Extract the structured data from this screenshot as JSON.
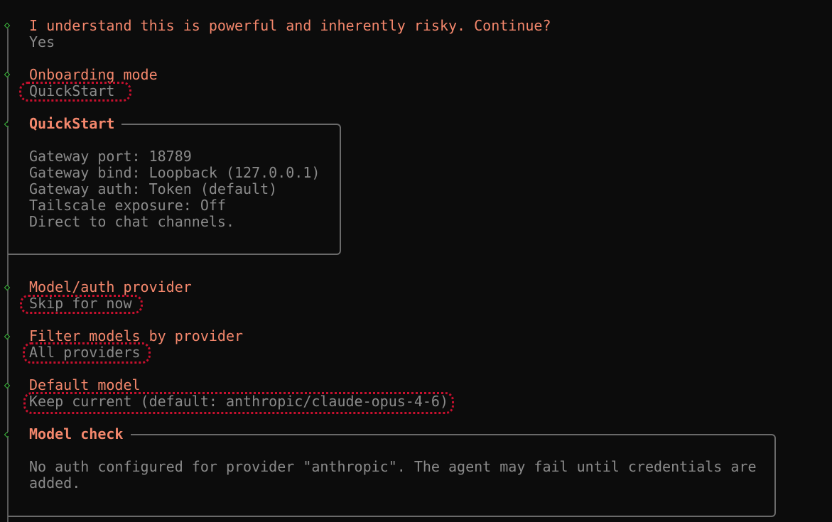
{
  "steps": {
    "risk": {
      "question": "I understand this is powerful and inherently risky. Continue?",
      "answer": "Yes"
    },
    "mode": {
      "question": "Onboarding mode",
      "answer": "QuickStart"
    },
    "quickstart_box": {
      "title": "QuickStart",
      "lines": [
        "Gateway port: 18789",
        "Gateway bind: Loopback (127.0.0.1)",
        "Gateway auth: Token (default)",
        "Tailscale exposure: Off",
        "Direct to chat channels."
      ]
    },
    "provider": {
      "question": "Model/auth provider",
      "answer": "Skip for now"
    },
    "filter": {
      "question": "Filter models by provider",
      "answer": "All providers"
    },
    "default_model": {
      "question": "Default model",
      "answer": "Keep current (default: anthropic/claude-opus-4-6)"
    },
    "model_check_box": {
      "title": "Model check",
      "lines": [
        "No auth configured for provider \"anthropic\". The agent may fail until credentials are",
        "added."
      ]
    }
  },
  "colors": {
    "background": "#0c0c0c",
    "prompt": "#f4876c",
    "value": "#8a8a8a",
    "bullet": "#3fbf3f",
    "highlight": "#c8102e"
  }
}
